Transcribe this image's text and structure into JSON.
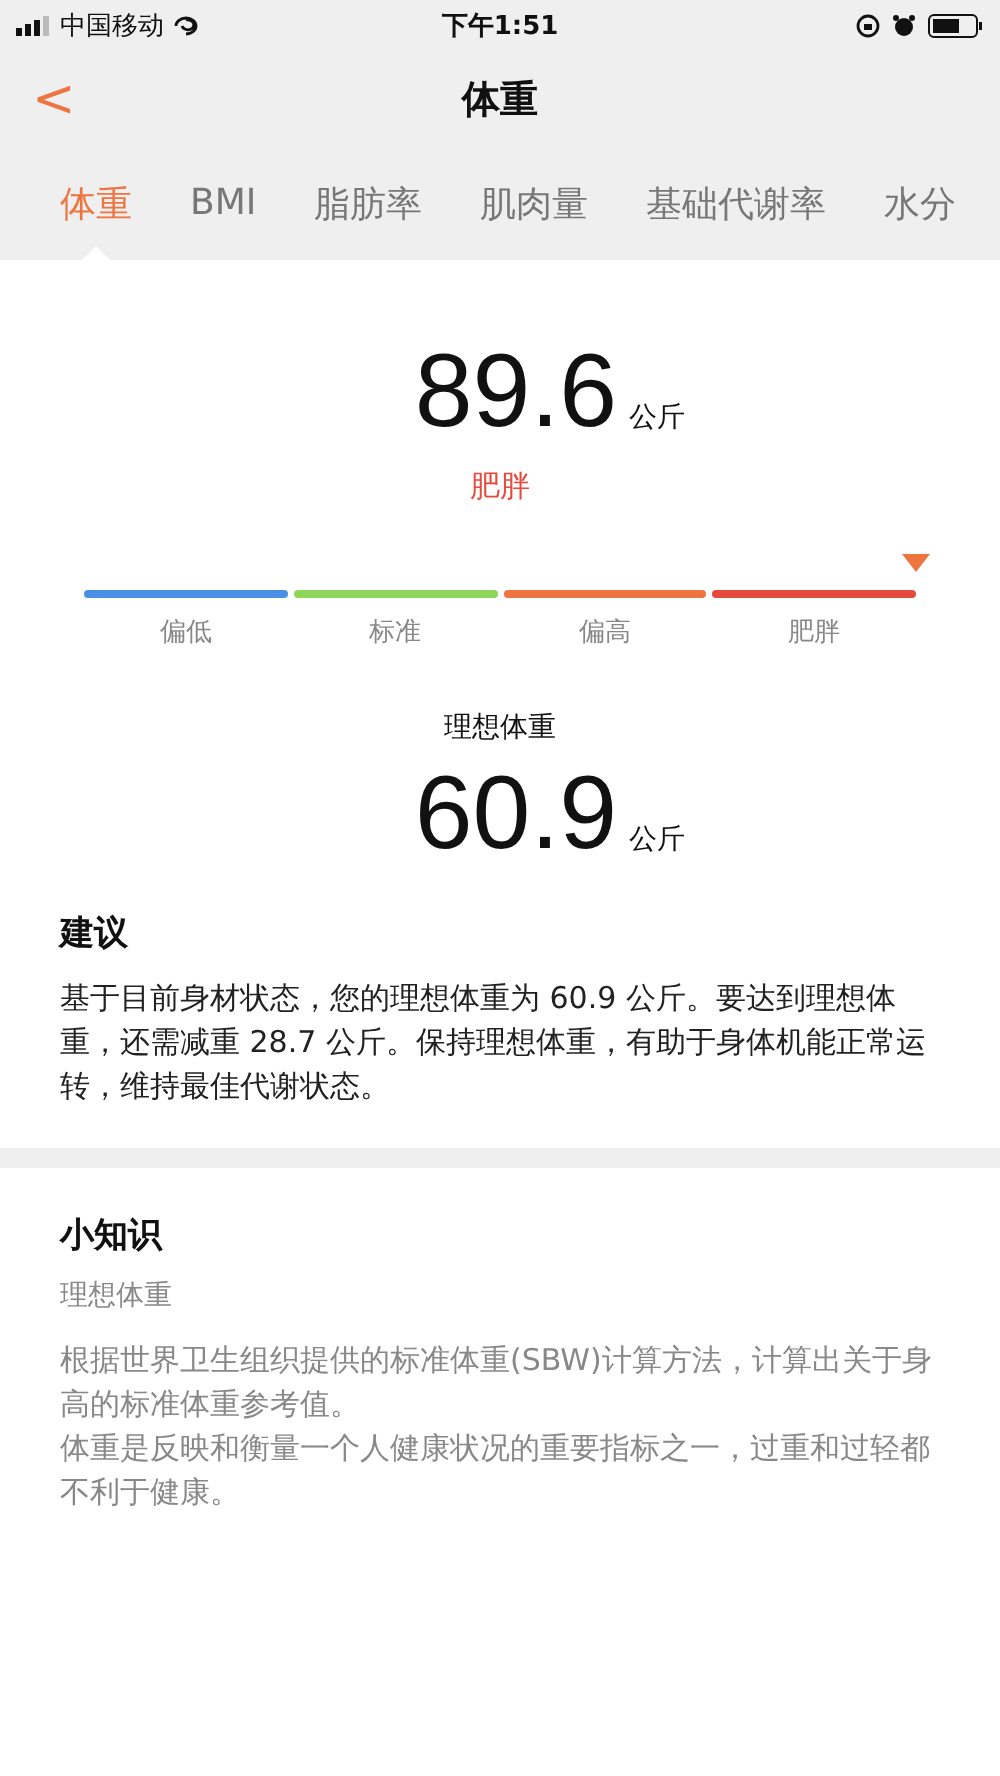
{
  "status_bar": {
    "carrier": "中国移动",
    "time": "下午1:51"
  },
  "header": {
    "back": "<",
    "title": "体重"
  },
  "tabs": [
    {
      "label": "体重",
      "selected": true
    },
    {
      "label": "BMI",
      "selected": false
    },
    {
      "label": "脂肪率",
      "selected": false
    },
    {
      "label": "肌肉量",
      "selected": false
    },
    {
      "label": "基础代谢率",
      "selected": false
    },
    {
      "label": "水分",
      "selected": false
    }
  ],
  "current": {
    "value": "89.6",
    "unit": "公斤",
    "status": "肥胖"
  },
  "scale": {
    "segments": [
      {
        "label": "偏低",
        "color": "#4a8fe6"
      },
      {
        "label": "标准",
        "color": "#8cd65a"
      },
      {
        "label": "偏高",
        "color": "#ee7440"
      },
      {
        "label": "肥胖",
        "color": "#e64a3c"
      }
    ]
  },
  "ideal": {
    "label": "理想体重",
    "value": "60.9",
    "unit": "公斤"
  },
  "advice": {
    "title": "建议",
    "text": "基于目前身材状态，您的理想体重为 60.9 公斤。要达到理想体重，还需减重 28.7 公斤。保持理想体重，有助于身体机能正常运转，维持最佳代谢状态。"
  },
  "knowledge": {
    "title": "小知识",
    "subtitle": "理想体重",
    "paragraphs": [
      "根据世界卫生组织提供的标准体重(SBW)计算方法，计算出关于身高的标准体重参考值。",
      "体重是反映和衡量一个人健康状况的重要指标之一，过重和过轻都不利于健康。"
    ]
  }
}
